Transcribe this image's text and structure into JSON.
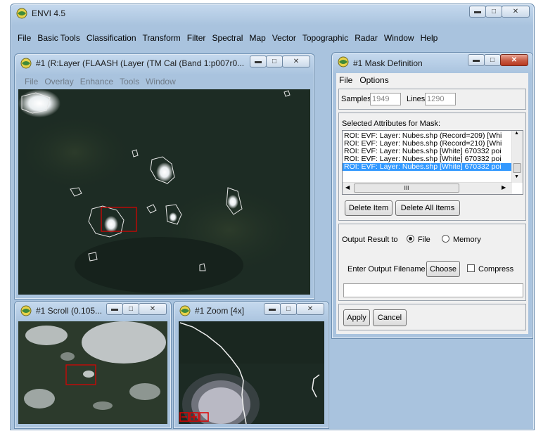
{
  "main_window": {
    "title": "ENVI 4.5",
    "menu": [
      "File",
      "Basic Tools",
      "Classification",
      "Transform",
      "Filter",
      "Spectral",
      "Map",
      "Vector",
      "Topographic",
      "Radar",
      "Window",
      "Help"
    ]
  },
  "image_window": {
    "title": "#1 (R:Layer (FLAASH (Layer (TM Cal (Band 1:p007r0...",
    "menu": [
      "File",
      "Overlay",
      "Enhance",
      "Tools",
      "Window"
    ]
  },
  "scroll_window": {
    "title": "#1 Scroll (0.105..."
  },
  "zoom_window": {
    "title": "#1 Zoom [4x]"
  },
  "mask_window": {
    "title": "#1 Mask Definition",
    "menu": [
      "File",
      "Options"
    ],
    "samples_label": "Samples",
    "samples_value": "1949",
    "lines_label": "Lines",
    "lines_value": "1290",
    "attributes_label": "Selected Attributes for Mask:",
    "attributes": [
      "ROI: EVF: Layer: Nubes.shp (Record=209) [Whi",
      "ROI: EVF: Layer: Nubes.shp (Record=210) [Whi",
      "ROI: EVF: Layer: Nubes.shp [White] 670332 poi",
      "ROI: EVF: Layer: Nubes.shp [White] 670332 poi",
      "ROI: EVF: Layer: Nubes.shp [White] 670332 poi"
    ],
    "selected_index": 4,
    "scroll_thumb": "III",
    "delete_item_label": "Delete Item",
    "delete_all_label": "Delete All Items",
    "output_label": "Output Result to",
    "output_file_label": "File",
    "output_memory_label": "Memory",
    "output_selected": "File",
    "filename_label": "Enter Output Filename",
    "choose_label": "Choose",
    "compress_label": "Compress",
    "filename_value": "",
    "apply_label": "Apply",
    "cancel_label": "Cancel"
  },
  "colors": {
    "selection": "#3399ff",
    "roi_box": "#e00000",
    "close_red": "#c75a43"
  }
}
